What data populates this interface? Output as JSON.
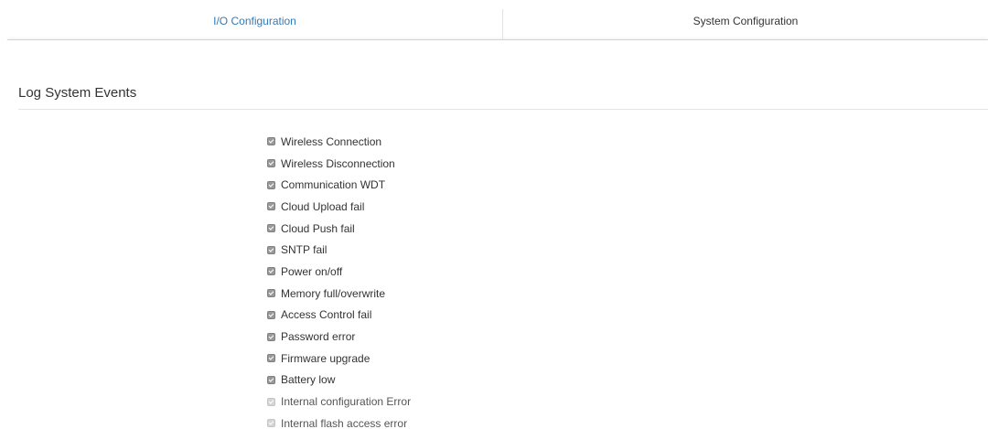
{
  "tabs": [
    {
      "label": "I/O Configuration",
      "active": true
    },
    {
      "label": "System Configuration",
      "active": false
    }
  ],
  "section": {
    "title": "Log System Events"
  },
  "events": [
    {
      "label": "Wireless Connection",
      "checked": true,
      "enabled": true
    },
    {
      "label": "Wireless Disconnection",
      "checked": true,
      "enabled": true
    },
    {
      "label": "Communication WDT",
      "checked": true,
      "enabled": true
    },
    {
      "label": "Cloud Upload fail",
      "checked": true,
      "enabled": true
    },
    {
      "label": "Cloud Push fail",
      "checked": true,
      "enabled": true
    },
    {
      "label": "SNTP fail",
      "checked": true,
      "enabled": true
    },
    {
      "label": "Power on/off",
      "checked": true,
      "enabled": true
    },
    {
      "label": "Memory full/overwrite",
      "checked": true,
      "enabled": true
    },
    {
      "label": "Access Control fail",
      "checked": true,
      "enabled": true
    },
    {
      "label": "Password error",
      "checked": true,
      "enabled": true
    },
    {
      "label": "Firmware upgrade",
      "checked": true,
      "enabled": true
    },
    {
      "label": "Battery low",
      "checked": true,
      "enabled": true
    },
    {
      "label": "Internal configuration Error",
      "checked": true,
      "enabled": false
    },
    {
      "label": "Internal flash access error",
      "checked": true,
      "enabled": false
    }
  ],
  "colors": {
    "active_tab": "#337ab7",
    "checkbox_enabled": "#9a9a9a",
    "checkbox_disabled": "#d5d5d5"
  }
}
